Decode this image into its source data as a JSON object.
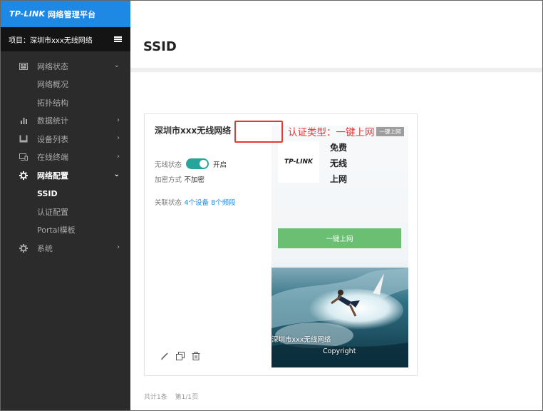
{
  "brand": {
    "logo": "TP-LINK",
    "title": "网络管理平台"
  },
  "project": {
    "label": "项目：深圳市xxx无线网络"
  },
  "menu": [
    {
      "label": "网络状态",
      "icon": "dashboard-icon",
      "chevron": "⌄"
    },
    {
      "label": "网络概况"
    },
    {
      "label": "拓扑结构"
    },
    {
      "label": "数据统计",
      "icon": "bar-chart-icon",
      "chevron": "›"
    },
    {
      "label": "设备列表",
      "icon": "device-list-icon",
      "chevron": "›"
    },
    {
      "label": "在线终端",
      "icon": "monitor-icon",
      "chevron": "›"
    },
    {
      "label": "网络配置",
      "icon": "gear-icon",
      "chevron": "⌄"
    },
    {
      "label": "SSID"
    },
    {
      "label": "认证配置"
    },
    {
      "label": "Portal模板"
    },
    {
      "label": "系统",
      "icon": "gear-icon",
      "chevron": "›"
    }
  ],
  "page": {
    "title": "SSID"
  },
  "card": {
    "ssid_name": "深圳市xxx无线网络",
    "wireless_label": "无线状态",
    "wireless_value": "开启",
    "wireless_on": true,
    "encryption_label": "加密方式",
    "encryption_value": "不加密",
    "association_label": "关联状态",
    "association_value": "4个设备 8个频段"
  },
  "preview": {
    "logo": "TP-LINK",
    "lines": [
      "免费",
      "无线",
      "上网"
    ],
    "button_label": "一键上网",
    "footer_text": "深圳市xxx无线网络",
    "copyright": "Copyright",
    "auth_badge": "一键上网"
  },
  "annotation": {
    "text": "认证类型：一键上网",
    "color": "#e53935"
  },
  "pagination": {
    "total": "共计1条",
    "page": "第1/1页"
  },
  "colors": {
    "brand_blue": "#1e88e5",
    "sidebar_bg": "#2b2b2b",
    "toggle_on": "#26a69a",
    "button_green": "#6bbf73"
  }
}
